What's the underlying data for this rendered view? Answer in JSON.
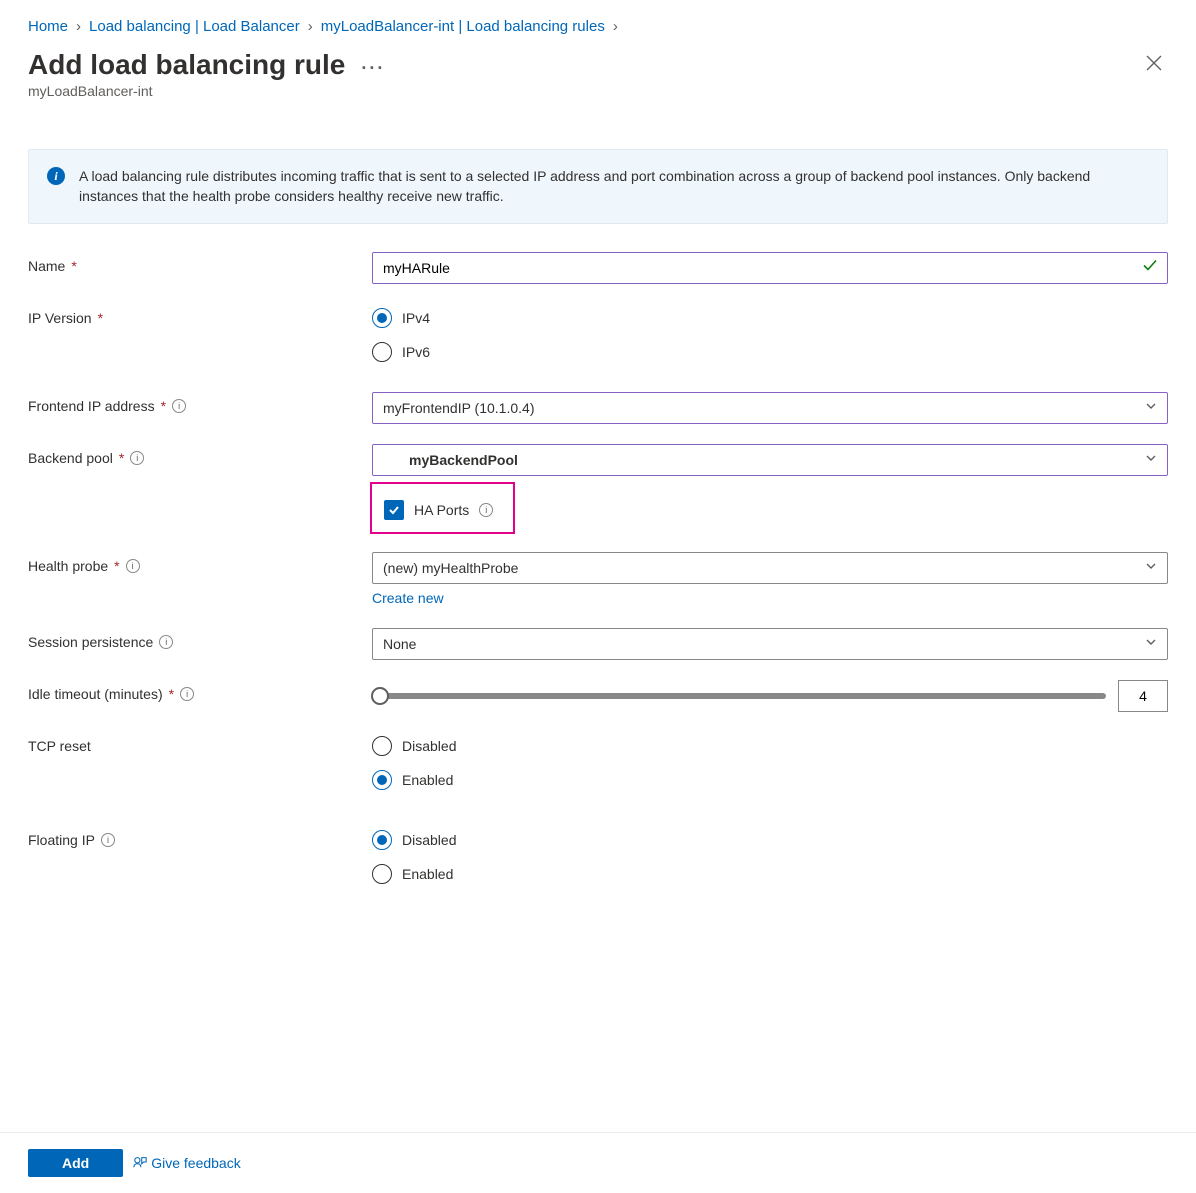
{
  "breadcrumb": {
    "home": "Home",
    "lb_list": "Load balancing | Load Balancer",
    "lb_instance": "myLoadBalancer-int | Load balancing rules"
  },
  "header": {
    "title": "Add load balancing rule",
    "subtitle": "myLoadBalancer-int"
  },
  "info": {
    "text": "A load balancing rule distributes incoming traffic that is sent to a selected IP address and port combination across a group of backend pool instances. Only backend instances that the health probe considers healthy receive new traffic."
  },
  "labels": {
    "name": "Name",
    "ip_version": "IP Version",
    "frontend_ip": "Frontend IP address",
    "backend_pool": "Backend pool",
    "ha_ports": "HA Ports",
    "health_probe": "Health probe",
    "create_new": "Create new",
    "session_persistence": "Session persistence",
    "idle_timeout": "Idle timeout (minutes)",
    "tcp_reset": "TCP reset",
    "floating_ip": "Floating IP"
  },
  "values": {
    "name": "myHARule",
    "frontend_ip": "myFrontendIP (10.1.0.4)",
    "backend_pool": "myBackendPool",
    "health_probe": "(new) myHealthProbe",
    "session_persistence": "None",
    "idle_timeout": "4",
    "ha_ports_checked": true
  },
  "options": {
    "ip_version": {
      "ipv4": "IPv4",
      "ipv6": "IPv6",
      "selected": "ipv4"
    },
    "tcp_reset": {
      "disabled": "Disabled",
      "enabled": "Enabled",
      "selected": "enabled"
    },
    "floating_ip": {
      "disabled": "Disabled",
      "enabled": "Enabled",
      "selected": "disabled"
    }
  },
  "footer": {
    "add": "Add",
    "feedback": "Give feedback"
  }
}
